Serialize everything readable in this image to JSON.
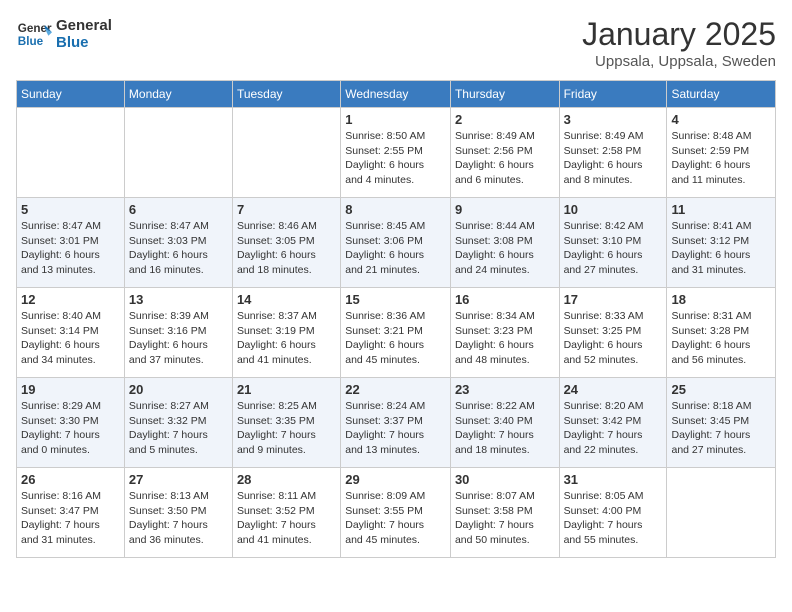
{
  "header": {
    "logo_general": "General",
    "logo_blue": "Blue",
    "month_year": "January 2025",
    "location": "Uppsala, Uppsala, Sweden"
  },
  "weekdays": [
    "Sunday",
    "Monday",
    "Tuesday",
    "Wednesday",
    "Thursday",
    "Friday",
    "Saturday"
  ],
  "weeks": [
    [
      {
        "day": "",
        "detail": ""
      },
      {
        "day": "",
        "detail": ""
      },
      {
        "day": "",
        "detail": ""
      },
      {
        "day": "1",
        "detail": "Sunrise: 8:50 AM\nSunset: 2:55 PM\nDaylight: 6 hours\nand 4 minutes."
      },
      {
        "day": "2",
        "detail": "Sunrise: 8:49 AM\nSunset: 2:56 PM\nDaylight: 6 hours\nand 6 minutes."
      },
      {
        "day": "3",
        "detail": "Sunrise: 8:49 AM\nSunset: 2:58 PM\nDaylight: 6 hours\nand 8 minutes."
      },
      {
        "day": "4",
        "detail": "Sunrise: 8:48 AM\nSunset: 2:59 PM\nDaylight: 6 hours\nand 11 minutes."
      }
    ],
    [
      {
        "day": "5",
        "detail": "Sunrise: 8:47 AM\nSunset: 3:01 PM\nDaylight: 6 hours\nand 13 minutes."
      },
      {
        "day": "6",
        "detail": "Sunrise: 8:47 AM\nSunset: 3:03 PM\nDaylight: 6 hours\nand 16 minutes."
      },
      {
        "day": "7",
        "detail": "Sunrise: 8:46 AM\nSunset: 3:05 PM\nDaylight: 6 hours\nand 18 minutes."
      },
      {
        "day": "8",
        "detail": "Sunrise: 8:45 AM\nSunset: 3:06 PM\nDaylight: 6 hours\nand 21 minutes."
      },
      {
        "day": "9",
        "detail": "Sunrise: 8:44 AM\nSunset: 3:08 PM\nDaylight: 6 hours\nand 24 minutes."
      },
      {
        "day": "10",
        "detail": "Sunrise: 8:42 AM\nSunset: 3:10 PM\nDaylight: 6 hours\nand 27 minutes."
      },
      {
        "day": "11",
        "detail": "Sunrise: 8:41 AM\nSunset: 3:12 PM\nDaylight: 6 hours\nand 31 minutes."
      }
    ],
    [
      {
        "day": "12",
        "detail": "Sunrise: 8:40 AM\nSunset: 3:14 PM\nDaylight: 6 hours\nand 34 minutes."
      },
      {
        "day": "13",
        "detail": "Sunrise: 8:39 AM\nSunset: 3:16 PM\nDaylight: 6 hours\nand 37 minutes."
      },
      {
        "day": "14",
        "detail": "Sunrise: 8:37 AM\nSunset: 3:19 PM\nDaylight: 6 hours\nand 41 minutes."
      },
      {
        "day": "15",
        "detail": "Sunrise: 8:36 AM\nSunset: 3:21 PM\nDaylight: 6 hours\nand 45 minutes."
      },
      {
        "day": "16",
        "detail": "Sunrise: 8:34 AM\nSunset: 3:23 PM\nDaylight: 6 hours\nand 48 minutes."
      },
      {
        "day": "17",
        "detail": "Sunrise: 8:33 AM\nSunset: 3:25 PM\nDaylight: 6 hours\nand 52 minutes."
      },
      {
        "day": "18",
        "detail": "Sunrise: 8:31 AM\nSunset: 3:28 PM\nDaylight: 6 hours\nand 56 minutes."
      }
    ],
    [
      {
        "day": "19",
        "detail": "Sunrise: 8:29 AM\nSunset: 3:30 PM\nDaylight: 7 hours\nand 0 minutes."
      },
      {
        "day": "20",
        "detail": "Sunrise: 8:27 AM\nSunset: 3:32 PM\nDaylight: 7 hours\nand 5 minutes."
      },
      {
        "day": "21",
        "detail": "Sunrise: 8:25 AM\nSunset: 3:35 PM\nDaylight: 7 hours\nand 9 minutes."
      },
      {
        "day": "22",
        "detail": "Sunrise: 8:24 AM\nSunset: 3:37 PM\nDaylight: 7 hours\nand 13 minutes."
      },
      {
        "day": "23",
        "detail": "Sunrise: 8:22 AM\nSunset: 3:40 PM\nDaylight: 7 hours\nand 18 minutes."
      },
      {
        "day": "24",
        "detail": "Sunrise: 8:20 AM\nSunset: 3:42 PM\nDaylight: 7 hours\nand 22 minutes."
      },
      {
        "day": "25",
        "detail": "Sunrise: 8:18 AM\nSunset: 3:45 PM\nDaylight: 7 hours\nand 27 minutes."
      }
    ],
    [
      {
        "day": "26",
        "detail": "Sunrise: 8:16 AM\nSunset: 3:47 PM\nDaylight: 7 hours\nand 31 minutes."
      },
      {
        "day": "27",
        "detail": "Sunrise: 8:13 AM\nSunset: 3:50 PM\nDaylight: 7 hours\nand 36 minutes."
      },
      {
        "day": "28",
        "detail": "Sunrise: 8:11 AM\nSunset: 3:52 PM\nDaylight: 7 hours\nand 41 minutes."
      },
      {
        "day": "29",
        "detail": "Sunrise: 8:09 AM\nSunset: 3:55 PM\nDaylight: 7 hours\nand 45 minutes."
      },
      {
        "day": "30",
        "detail": "Sunrise: 8:07 AM\nSunset: 3:58 PM\nDaylight: 7 hours\nand 50 minutes."
      },
      {
        "day": "31",
        "detail": "Sunrise: 8:05 AM\nSunset: 4:00 PM\nDaylight: 7 hours\nand 55 minutes."
      },
      {
        "day": "",
        "detail": ""
      }
    ]
  ]
}
